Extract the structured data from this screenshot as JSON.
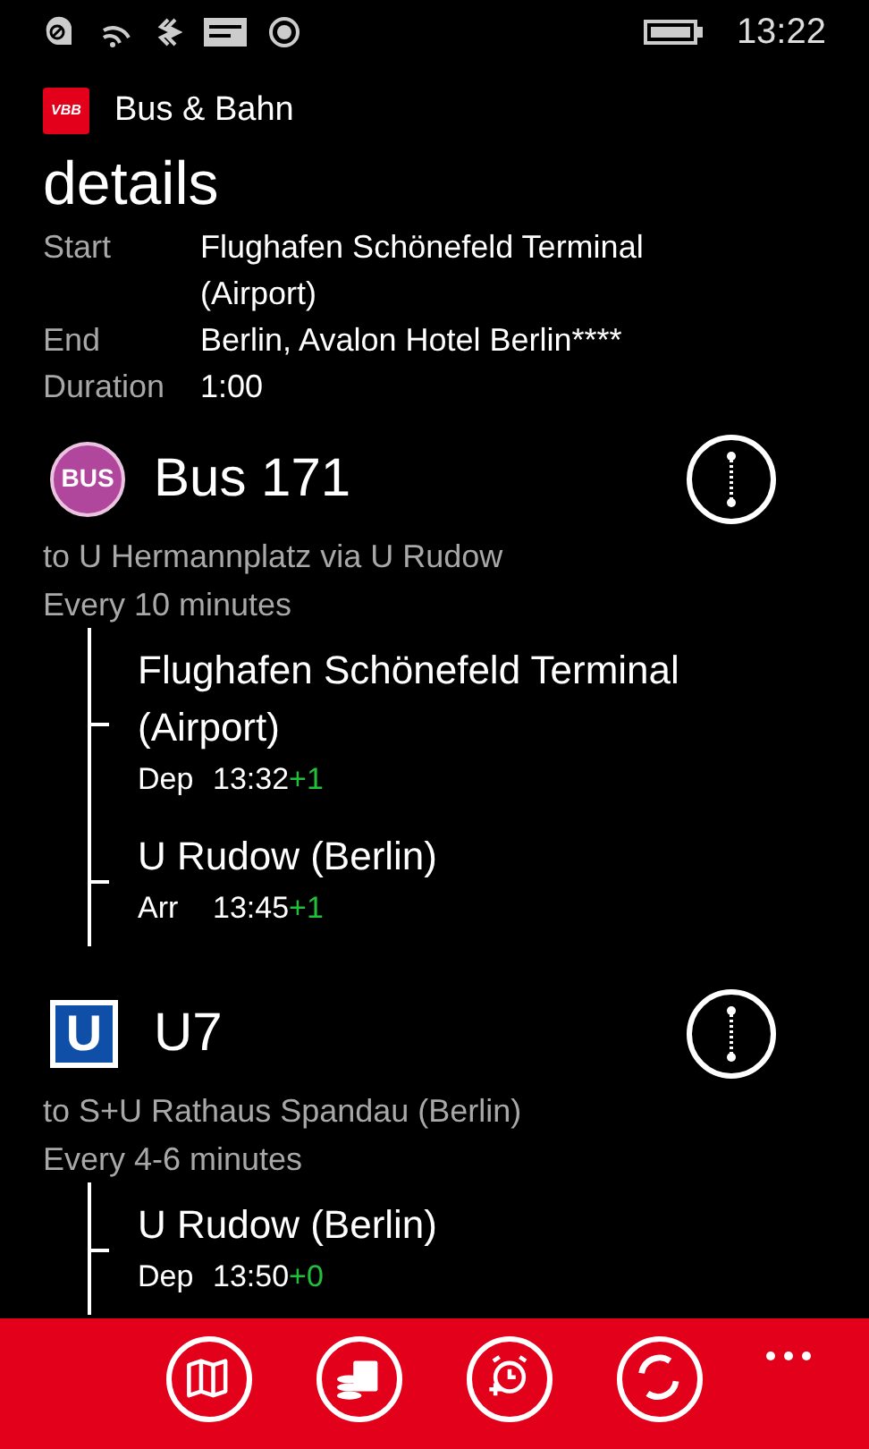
{
  "status_bar": {
    "time": "13:22"
  },
  "app": {
    "logo_text": "VBB",
    "title": "Bus & Bahn"
  },
  "page_title": "details",
  "summary": [
    {
      "label": "Start",
      "value": "Flughafen Schönefeld Terminal (Airport)"
    },
    {
      "label": "End",
      "value": "Berlin, Avalon Hotel Berlin****"
    },
    {
      "label": "Duration",
      "value": "1:00"
    }
  ],
  "legs": [
    {
      "kind": "bus",
      "badge": "BUS",
      "line": "Bus 171",
      "direction": "to U Hermannplatz via U Rudow",
      "frequency": "Every 10 minutes",
      "stops": [
        {
          "name": "Flughafen Schönefeld Terminal (Airport)",
          "label": "Dep",
          "time": "13:32",
          "delay": "+1"
        },
        {
          "name": "U Rudow (Berlin)",
          "label": "Arr",
          "time": "13:45",
          "delay": "+1"
        }
      ]
    },
    {
      "kind": "subway",
      "badge": "U",
      "line": "U7",
      "direction": "to S+U Rathaus Spandau (Berlin)",
      "frequency": "Every 4-6 minutes",
      "stops": [
        {
          "name": "U Rudow (Berlin)",
          "label": "Dep",
          "time": "13:50",
          "delay": "+0"
        }
      ]
    }
  ],
  "app_bar": {
    "buttons": [
      {
        "kind": "map"
      },
      {
        "kind": "fare"
      },
      {
        "kind": "alarm"
      },
      {
        "kind": "refresh"
      }
    ]
  }
}
